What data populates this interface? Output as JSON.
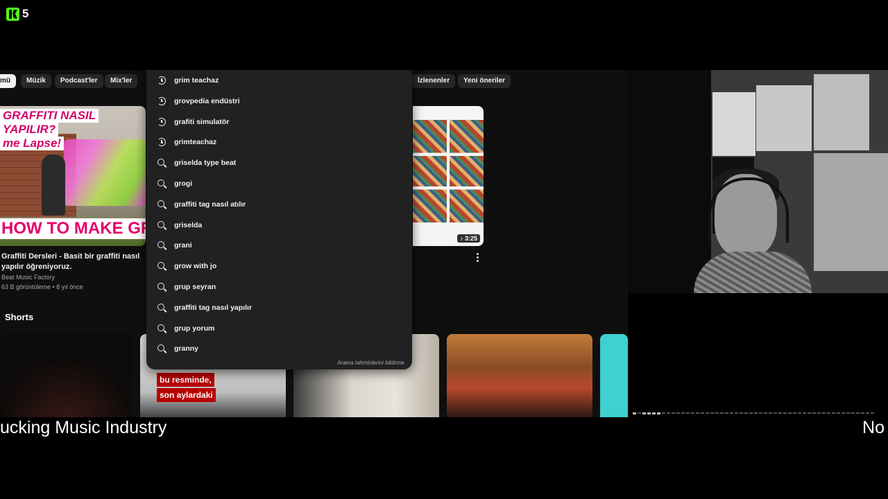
{
  "overlay": {
    "logo_count": "5"
  },
  "chips": [
    "mü",
    "Müzik",
    "Podcast'ler",
    "Mix'ler",
    "İzlenenler",
    "Yeni öneriler"
  ],
  "video1": {
    "thumb_lines": [
      "GRAFFITI NASIL",
      "YAPILIR?",
      "me Lapse!"
    ],
    "thumb_bottom": "HOW TO MAKE GR",
    "title": "Graffiti Dersleri - Basit bir graffiti nasıl yapılır öğreniyoruz.",
    "channel": "Beat Music Factory",
    "stats": "63 B görüntüleme • 8 yıl önce"
  },
  "video2": {
    "duration": "♪ 3:25"
  },
  "shorts": {
    "title": "Shorts",
    "caption_lines": [
      "bu resminde,",
      "son aylardaki"
    ]
  },
  "suggestions": [
    {
      "text": "grim teachaz",
      "icon": "history-icon"
    },
    {
      "text": "grovpedia endüstri",
      "icon": "history-icon"
    },
    {
      "text": "grafiti simulatör",
      "icon": "history-icon"
    },
    {
      "text": "grimteachaz",
      "icon": "history-icon"
    },
    {
      "text": "griselda type beat",
      "icon": "search-icon"
    },
    {
      "text": "grogi",
      "icon": "search-icon"
    },
    {
      "text": "graffiti tag nasıl atılır",
      "icon": "search-icon"
    },
    {
      "text": "griselda",
      "icon": "search-icon"
    },
    {
      "text": "grani",
      "icon": "search-icon"
    },
    {
      "text": "grow with jo",
      "icon": "search-icon"
    },
    {
      "text": "grup seyran",
      "icon": "search-icon"
    },
    {
      "text": "graffiti tag nasıl yapılır",
      "icon": "search-icon"
    },
    {
      "text": "grup yorum",
      "icon": "search-icon"
    },
    {
      "text": "granny",
      "icon": "search-icon"
    }
  ],
  "report_text": "Arama tahminlerini bildirme",
  "ticker": {
    "left": "ucking Music Industry",
    "right": "No"
  }
}
